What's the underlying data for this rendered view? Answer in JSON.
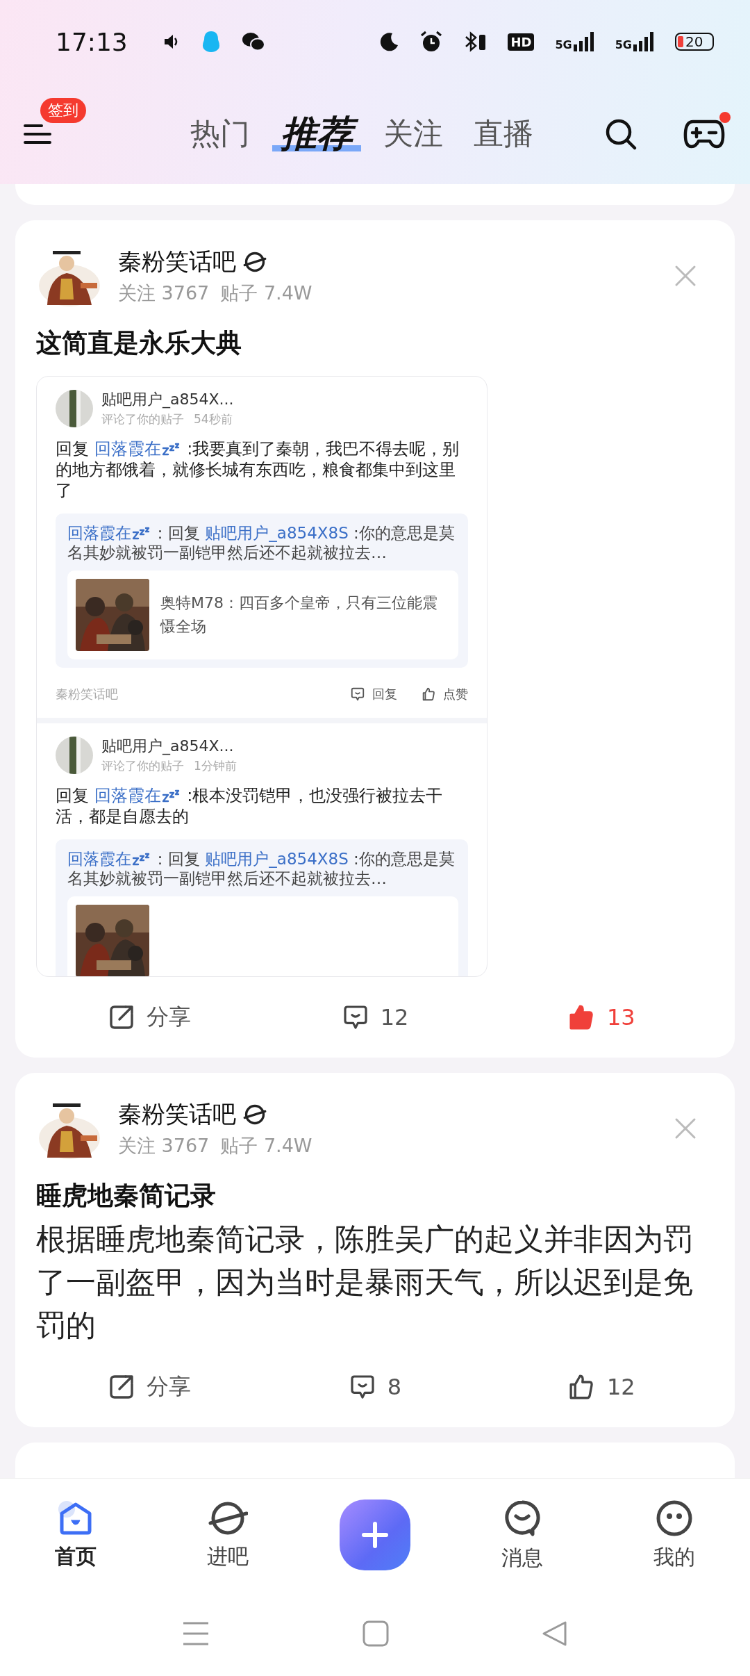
{
  "status_bar": {
    "time": "17:13",
    "hd_label": "HD",
    "network_1": "5G",
    "network_2": "5G",
    "battery": "20"
  },
  "header": {
    "sign_in_badge": "签到",
    "notification_dot": true,
    "tabs": [
      {
        "label": "热门",
        "selected": false
      },
      {
        "label": "推荐",
        "selected": true
      },
      {
        "label": "关注",
        "selected": false
      },
      {
        "label": "直播",
        "selected": false
      }
    ]
  },
  "posts": [
    {
      "forum": "秦粉笑话吧",
      "followers": "关注 3767",
      "post_count": "贴子 7.4W",
      "title": "这简直是永乐大典",
      "screenshot": {
        "comments": [
          {
            "user": "贴吧用户_a854X...",
            "meta": "评论了你的贴子",
            "time": "54秒前",
            "reply_prefix": "回复",
            "mention": "回落霞在",
            "reply": ":我要真到了秦朝，我巴不得去呢，别的地方都饿着，就修长城有东西吃，粮食都集中到这里了",
            "quote": {
              "author": "回落霞在",
              "separator": "：回复",
              "target": "贴吧用户_a854X8S",
              "text": ":你的意思是莫名其妙就被罚一副铠甲然后还不起就被拉去…",
              "nested": {
                "kind": "picture",
                "text": "奥特M78：四百多个皇帝，只有三位能震慑全场"
              }
            },
            "footer": {
              "forum": "秦粉笑话吧",
              "reply": "回复",
              "like": "点赞"
            }
          },
          {
            "user": "贴吧用户_a854X...",
            "meta": "评论了你的贴子",
            "time": "1分钟前",
            "reply_prefix": "回复",
            "mention": "回落霞在",
            "reply": ":根本没罚铠甲，也没强行被拉去干活，都是自愿去的",
            "quote": {
              "author": "回落霞在",
              "separator": "：回复",
              "target": "贴吧用户_a854X8S",
              "text": ":你的意思是莫名其妙就被罚一副铠甲然后还不起就被拉去…"
            }
          }
        ]
      },
      "actions": {
        "share": "分享",
        "comments": "12",
        "likes": "13",
        "liked": true
      }
    },
    {
      "forum": "秦粉笑话吧",
      "followers": "关注 3767",
      "post_count": "贴子 7.4W",
      "title": "睡虎地秦简记录",
      "body": "根据睡虎地秦简记录，陈胜吴广的起义并非因为罚了一副盔甲，因为当时是暴雨天气，所以迟到是免罚的",
      "actions": {
        "share": "分享",
        "comments": "8",
        "likes": "12",
        "liked": false
      }
    }
  ],
  "bottom_nav": [
    {
      "kind": "tab",
      "label": "首页",
      "selected": true
    },
    {
      "kind": "tab",
      "label": "进吧",
      "selected": false
    },
    {
      "kind": "compose"
    },
    {
      "kind": "tab",
      "label": "消息",
      "selected": false
    },
    {
      "kind": "tab",
      "label": "我的",
      "selected": false
    }
  ]
}
